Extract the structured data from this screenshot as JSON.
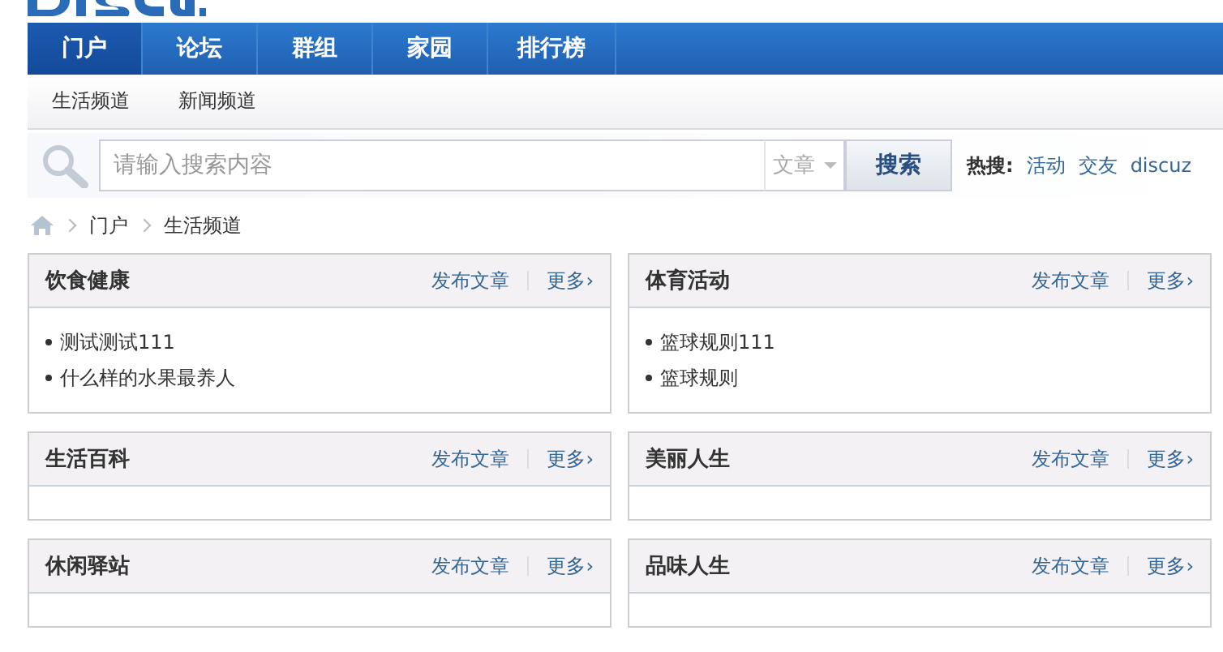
{
  "nav": {
    "items": [
      {
        "label": "门户",
        "selected": true
      },
      {
        "label": "论坛",
        "selected": false
      },
      {
        "label": "群组",
        "selected": false
      },
      {
        "label": "家园",
        "selected": false
      },
      {
        "label": "排行榜",
        "selected": false
      }
    ]
  },
  "subnav": [
    "生活频道",
    "新闻频道"
  ],
  "search": {
    "placeholder": "请输入搜索内容",
    "type": "文章",
    "button": "搜索",
    "hot_label": "热搜:",
    "hot": [
      "活动",
      "交友",
      "discuz"
    ]
  },
  "breadcrumb": [
    "门户",
    "生活频道"
  ],
  "sections": [
    {
      "title": "饮食健康",
      "publish": "发布文章",
      "more": "更多›",
      "items": [
        "测试测试111",
        "什么样的水果最养人"
      ]
    },
    {
      "title": "体育活动",
      "publish": "发布文章",
      "more": "更多›",
      "items": [
        "篮球规则111",
        "篮球规则"
      ]
    },
    {
      "title": "生活百科",
      "publish": "发布文章",
      "more": "更多›"
    },
    {
      "title": "美丽人生",
      "publish": "发布文章",
      "more": "更多›"
    },
    {
      "title": "休闲驿站",
      "publish": "发布文章",
      "more": "更多›"
    },
    {
      "title": "品味人生",
      "publish": "发布文章",
      "more": "更多›"
    }
  ]
}
